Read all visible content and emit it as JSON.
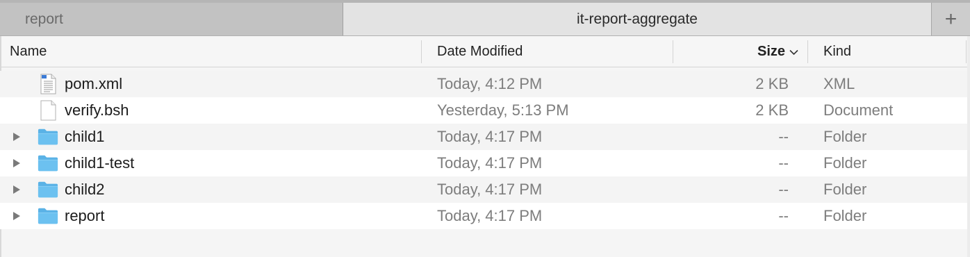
{
  "tabs": {
    "inactive": "report",
    "active": "it-report-aggregate",
    "add_label": "+"
  },
  "columns": {
    "name": "Name",
    "date": "Date Modified",
    "size": "Size",
    "kind": "Kind"
  },
  "files": [
    {
      "name": "pom.xml",
      "date": "Today, 4:12 PM",
      "size": "2 KB",
      "kind": "XML",
      "icon": "xml-file-icon",
      "expandable": false
    },
    {
      "name": "verify.bsh",
      "date": "Yesterday, 5:13 PM",
      "size": "2 KB",
      "kind": "Document",
      "icon": "document-icon",
      "expandable": false
    },
    {
      "name": "child1",
      "date": "Today, 4:17 PM",
      "size": "--",
      "kind": "Folder",
      "icon": "folder-icon",
      "expandable": true
    },
    {
      "name": "child1-test",
      "date": "Today, 4:17 PM",
      "size": "--",
      "kind": "Folder",
      "icon": "folder-icon",
      "expandable": true
    },
    {
      "name": "child2",
      "date": "Today, 4:17 PM",
      "size": "--",
      "kind": "Folder",
      "icon": "folder-icon",
      "expandable": true
    },
    {
      "name": "report",
      "date": "Today, 4:17 PM",
      "size": "--",
      "kind": "Folder",
      "icon": "folder-icon",
      "expandable": true
    }
  ],
  "colors": {
    "folder": "#6cc1f0",
    "secondary_text": "#7d7d7d"
  }
}
